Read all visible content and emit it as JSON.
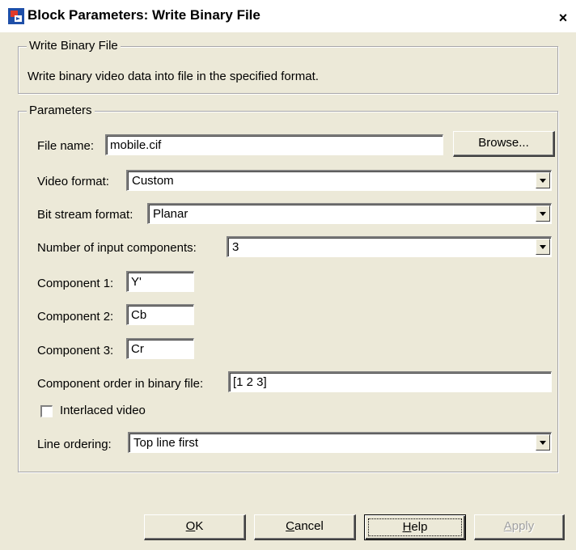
{
  "window": {
    "title": "Block Parameters: Write Binary File",
    "close_label": "×"
  },
  "description_group": {
    "legend": "Write Binary File",
    "text": "Write binary video data into file in the specified format."
  },
  "parameters_group": {
    "legend": "Parameters",
    "file_name_label": "File name:",
    "file_name_value": "mobile.cif",
    "browse_label": "Browse...",
    "video_format_label": "Video format:",
    "video_format_value": "Custom",
    "bit_stream_label": "Bit stream format:",
    "bit_stream_value": "Planar",
    "num_components_label": "Number of input components:",
    "num_components_value": "3",
    "component1_label": "Component 1:",
    "component1_value": "Y'",
    "component2_label": "Component 2:",
    "component2_value": "Cb",
    "component3_label": "Component 3:",
    "component3_value": "Cr",
    "component_order_label": "Component order in binary file:",
    "component_order_value": "[1 2 3]",
    "interlaced_label": "Interlaced video",
    "interlaced_checked": false,
    "line_ordering_label": "Line ordering:",
    "line_ordering_value": "Top line first"
  },
  "buttons": {
    "ok_mnemonic": "O",
    "ok_rest": "K",
    "cancel_mnemonic": "C",
    "cancel_rest": "ancel",
    "help_mnemonic": "H",
    "help_rest": "elp",
    "apply_mnemonic": "A",
    "apply_rest": "pply"
  }
}
